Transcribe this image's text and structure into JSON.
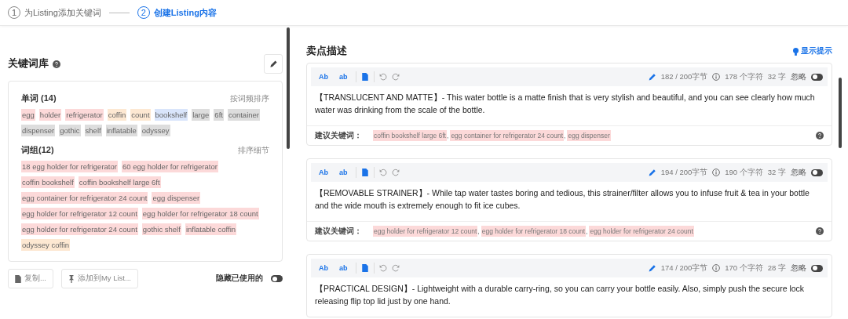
{
  "steps": [
    {
      "number": "1",
      "label": "为Listing添加关键词",
      "selected": false
    },
    {
      "number": "2",
      "label": "创建Listing内容",
      "selected": true
    }
  ],
  "keyword_library": {
    "title": "关键词库",
    "words": {
      "title": "单词",
      "count": "(14)",
      "sort": "按词频排序",
      "tags": [
        {
          "text": "egg",
          "color": "#fcd9d9"
        },
        {
          "text": "holder",
          "color": "#fcd9d9"
        },
        {
          "text": "refrigerator",
          "color": "#fcd9d9"
        },
        {
          "text": "coffin",
          "color": "#fde8d2"
        },
        {
          "text": "count",
          "color": "#fde8d2"
        },
        {
          "text": "bookshelf",
          "color": "#d9e5fb"
        },
        {
          "text": "large",
          "color": "#dddddd"
        },
        {
          "text": "6ft",
          "color": "#dddddd"
        },
        {
          "text": "container",
          "color": "#dddddd"
        },
        {
          "text": "dispenser",
          "color": "#dddddd"
        },
        {
          "text": "gothic",
          "color": "#dddddd"
        },
        {
          "text": "shelf",
          "color": "#dddddd"
        },
        {
          "text": "inflatable",
          "color": "#dddddd"
        },
        {
          "text": "odyssey",
          "color": "#dddddd"
        }
      ]
    },
    "phrases": {
      "title": "词组",
      "count": "(12)",
      "sort": "排序细节",
      "tags": [
        {
          "text": "18 egg holder for refrigerator",
          "color": "#fcd9d9"
        },
        {
          "text": "60 egg holder for refrigerator",
          "color": "#fcd9d9"
        },
        {
          "text": "coffin bookshelf",
          "color": "#fcd9d9"
        },
        {
          "text": "coffin bookshelf large 6ft",
          "color": "#fcd9d9"
        },
        {
          "text": "egg container for refrigerator 24 count",
          "color": "#fcd9d9"
        },
        {
          "text": "egg dispenser",
          "color": "#fcd9d9"
        },
        {
          "text": "egg holder for refrigerator 12 count",
          "color": "#fcd9d9"
        },
        {
          "text": "egg holder for refrigerator 18 count",
          "color": "#fcd9d9"
        },
        {
          "text": "egg holder for refrigerator 24 count",
          "color": "#fcd9d9"
        },
        {
          "text": "gothic shelf",
          "color": "#fcd9d9"
        },
        {
          "text": "inflatable coffin",
          "color": "#fcd9d9"
        },
        {
          "text": "odyssey coffin",
          "color": "#fde8d2"
        }
      ]
    },
    "buttons": [
      "复制...",
      "添加到My List..."
    ],
    "hide_used": {
      "label": "隐藏已使用的",
      "on": false
    }
  },
  "bullets": {
    "title": "卖点描述",
    "hint_link": "显示提示",
    "cards": [
      {
        "toolbar": {
          "bold_label": "Ab",
          "lower_label": "ab",
          "bytes": "182 / 200字节",
          "chars": "178 个字符",
          "words": "32 字",
          "ignore": "忽略",
          "ignore_on": false
        },
        "text": "【TRANSLUCENT AND MATTE】- This water bottle is a matte finish that is very stylish and beautiful, and you can see clearly how much water was drinking from the scale of the bottle.",
        "suggest_label": "建议关键词：",
        "suggestions": [
          {
            "text": "coffin bookshelf large 6ft",
            "separator": ","
          },
          {
            "text": "egg container for refrigerator 24 count",
            "separator": ","
          },
          {
            "text": "egg dispenser"
          }
        ]
      },
      {
        "toolbar": {
          "bold_label": "Ab",
          "lower_label": "ab",
          "bytes": "194 / 200字节",
          "chars": "190 个字符",
          "words": "32 字",
          "ignore": "忽略",
          "ignore_on": false
        },
        "text": "【REMOVABLE STRAINER】- While tap water tastes boring and tedious, this strainer/filter allows you to infuse fruit & tea in your bottle and the wide mouth is extremely enough to fit ice cubes.",
        "suggest_label": "建议关键词：",
        "suggestions": [
          {
            "text": "egg holder for refrigerator 12 count",
            "separator": ","
          },
          {
            "text": "egg holder for refrigerator 18 count",
            "separator": ","
          },
          {
            "text": "egg holder for refrigerator 24 count"
          }
        ]
      },
      {
        "toolbar": {
          "bold_label": "Ab",
          "lower_label": "ab",
          "bytes": "174 / 200字节",
          "chars": "170 个字符",
          "words": "28 字",
          "ignore": "忽略",
          "ignore_on": false
        },
        "text": "【PRACTICAL DESIGN】- Lightweight with a durable carry-ring, so you can carry your bottle easily. Also, simply push the secure lock releasing flip top lid just by one hand."
      }
    ]
  }
}
